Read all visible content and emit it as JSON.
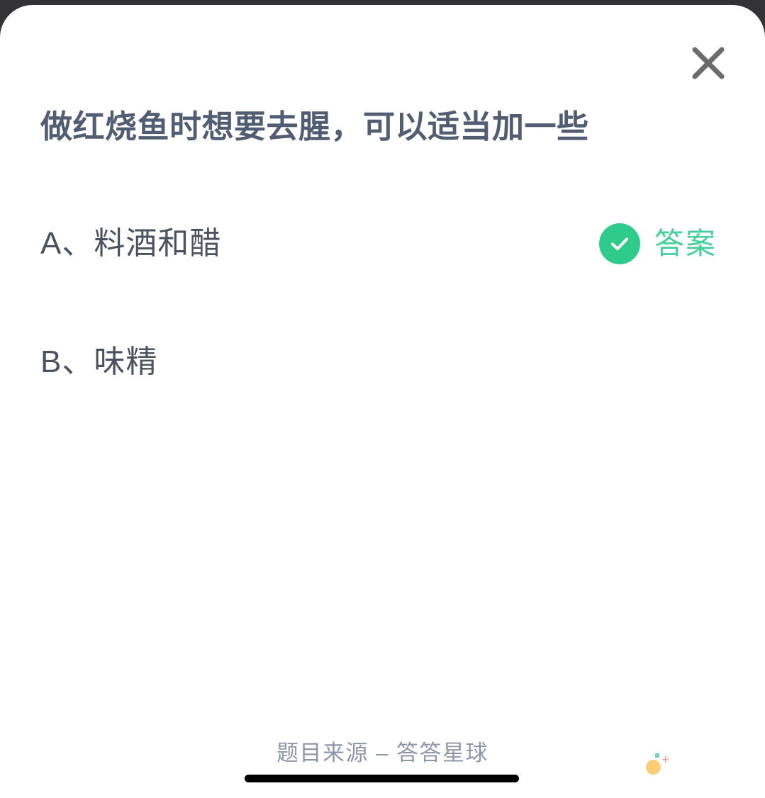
{
  "window": {
    "close_icon": "close-x-icon"
  },
  "question": {
    "title": "做红烧鱼时想要去腥，可以适当加一些"
  },
  "options": [
    {
      "key": "A",
      "label": "A、料酒和醋",
      "is_answer": true
    },
    {
      "key": "B",
      "label": "B、味精",
      "is_answer": false
    }
  ],
  "answer_badge": {
    "icon": "check-mark-icon",
    "text": "答案",
    "color": "#45cf9b",
    "circle_color": "#2ecb8b"
  },
  "footer": {
    "source": "题目来源 – 答答星球"
  },
  "decoration": {
    "sparkle_dot_color": "#fbc45c",
    "sparkle_plus": "+",
    "sparkle_plus_color": "#f08a6a",
    "sparkle_square_color": "#4ec9b0"
  },
  "system": {
    "home_indicator": "home-indicator-bar"
  },
  "colors": {
    "title": "#515d73",
    "option_text": "#4a5160",
    "footer_text": "#8d97ab",
    "card_background": "#ffffff",
    "frame_background": "#333336"
  }
}
